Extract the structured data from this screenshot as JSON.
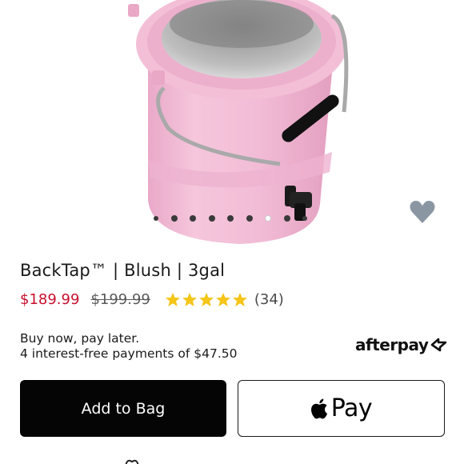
{
  "product": {
    "title": "BackTap™ | Blush | 3gal",
    "price": "$189.99",
    "compare_price": "$199.99",
    "rating": 5,
    "review_count": "(34)"
  },
  "gallery": {
    "image_count": 9,
    "active_index": 6,
    "product_color": "#f1bdd6"
  },
  "bnpl": {
    "line1": "Buy now, pay later.",
    "line2": "4 interest-free payments of $47.50",
    "provider": "afterpay"
  },
  "actions": {
    "add_to_bag": "Add to Bag",
    "apple_pay": "Pay"
  },
  "colors": {
    "sale_price": "#c8102e",
    "star": "#f5c518",
    "primary_button": "#050505",
    "favorite_icon": "#8a97a3"
  },
  "icons": {
    "favorite": "heart-icon",
    "rating": "star-icon",
    "apple": "apple-icon",
    "afterpay": "afterpay-logo-icon"
  }
}
